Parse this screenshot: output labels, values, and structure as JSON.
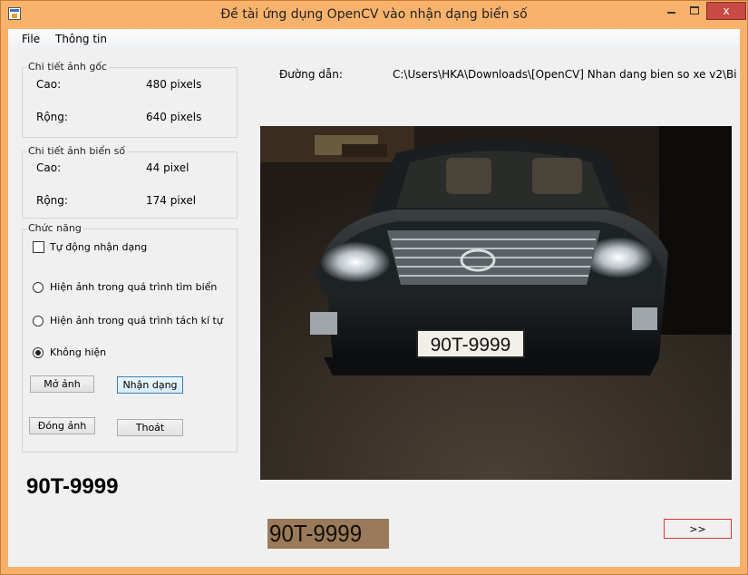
{
  "window": {
    "title": "Đề tài ứng dụng OpenCV vào nhận dạng biển số",
    "close_label": "x"
  },
  "menu": [
    "File",
    "Thông tin"
  ],
  "original_image": {
    "group_title": "Chi tiết ảnh gốc",
    "height_label": "Cao:",
    "height_value": "480 pixels",
    "width_label": "Rộng:",
    "width_value": "640 pixels"
  },
  "plate_image": {
    "group_title": "Chi tiết ảnh biển số",
    "height_label": "Cao:",
    "height_value": "44 pixel",
    "width_label": "Rộng:",
    "width_value": "174 pixel"
  },
  "functions": {
    "group_title": "Chức năng",
    "auto_recognize": {
      "label": "Tự động nhận dạng",
      "checked": false
    },
    "radios": [
      {
        "label": "Hiện ảnh trong quá trình tìm biển",
        "checked": false
      },
      {
        "label": "Hiện ảnh trong quá trình tách kí tự",
        "checked": false
      },
      {
        "label": "Không hiện",
        "checked": true
      }
    ],
    "buttons": {
      "open": "Mở ảnh",
      "recognize": "Nhận dạng",
      "close": "Đóng ảnh",
      "exit": "Thoát"
    }
  },
  "result": {
    "plate_number": "90T-9999"
  },
  "path": {
    "label": "Đường dẫn:",
    "value": "C:\\Users\\HKA\\Downloads\\[OpenCV] Nhan dang bien so xe v2\\Bi"
  },
  "photo": {
    "plate_text": "90T-9999"
  },
  "plate_crop": {
    "text": "90T-9999"
  },
  "next_button": {
    "label": ">>"
  }
}
